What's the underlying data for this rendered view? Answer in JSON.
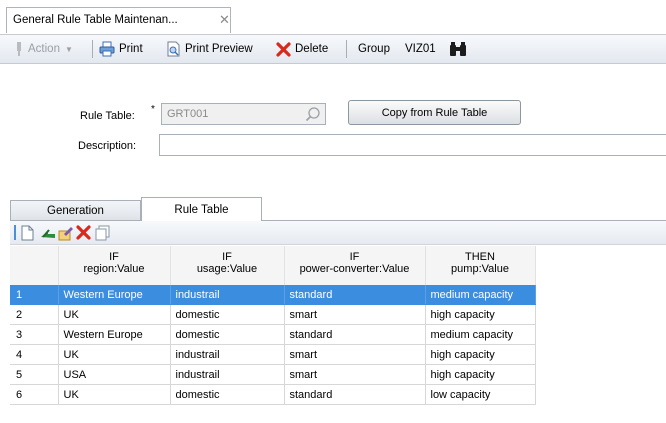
{
  "doc_tab": {
    "title": "General Rule Table Maintenan...",
    "close": "✕"
  },
  "toolbar": {
    "action": "Action",
    "print": "Print",
    "print_preview": "Print Preview",
    "delete": "Delete",
    "group_label": "Group",
    "group_value": "VIZ01"
  },
  "form": {
    "rule_table_label": "Rule Table:",
    "required_marker": "*",
    "rule_table_value": "GRT001",
    "copy_button": "Copy from Rule Table",
    "description_label": "Description:",
    "description_value": ""
  },
  "tabs": {
    "generation": "Generation",
    "rule_table": "Rule Table"
  },
  "grid": {
    "headers": [
      {
        "top": "",
        "bottom": ""
      },
      {
        "top": "IF",
        "bottom": "region:Value"
      },
      {
        "top": "IF",
        "bottom": "usage:Value"
      },
      {
        "top": "IF",
        "bottom": "power-converter:Value"
      },
      {
        "top": "THEN",
        "bottom": "pump:Value"
      }
    ],
    "rows": [
      [
        "1",
        "Western Europe",
        "industrail",
        "standard",
        "medium capacity"
      ],
      [
        "2",
        "UK",
        "domestic",
        "smart",
        "high capacity"
      ],
      [
        "3",
        "Western Europe",
        "domestic",
        "standard",
        "medium capacity"
      ],
      [
        "4",
        "UK",
        "industrail",
        "smart",
        "high capacity"
      ],
      [
        "5",
        "USA",
        "industrail",
        "smart",
        "high capacity"
      ],
      [
        "6",
        "UK",
        "domestic",
        "standard",
        "low capacity"
      ]
    ],
    "selected_row": 0
  },
  "colors": {
    "selection": "#3b8de0",
    "delete_red": "#d9281c"
  }
}
